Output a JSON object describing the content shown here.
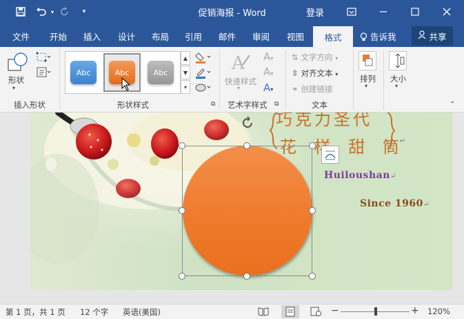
{
  "titlebar": {
    "doc_title": "促销海报 - Word",
    "login": "登录",
    "icons": [
      "save-icon",
      "undo-icon",
      "redo-icon",
      "customize-icon",
      "ribbon-display-icon",
      "minimize-icon",
      "maximize-icon",
      "close-icon"
    ]
  },
  "tabs": {
    "items": [
      "文件",
      "开始",
      "插入",
      "设计",
      "布局",
      "引用",
      "邮件",
      "审阅",
      "视图"
    ],
    "active": "格式",
    "tell_me": "告诉我",
    "share": "共享"
  },
  "ribbon": {
    "insert_shapes": {
      "shapes_label": "形状",
      "group_label": "插入形状"
    },
    "shape_styles": {
      "group_label": "形状样式",
      "presets": [
        {
          "label": "Abc",
          "color": "#4a90d9"
        },
        {
          "label": "Abc",
          "color": "#ed7d31"
        },
        {
          "label": "Abc",
          "color": "#a5a5a5"
        }
      ]
    },
    "wordart": {
      "quick_styles": "快速样式",
      "group_label": "艺术字样式"
    },
    "text": {
      "direction": "文字方向",
      "align": "对齐文本",
      "link": "创建链接",
      "group_label": "文本"
    },
    "arrange": {
      "label": "排列"
    },
    "size": {
      "label": "大小"
    }
  },
  "document": {
    "headline_line1": "巧克力圣代",
    "headline_line2": "花 样 甜 筒",
    "brand": "Huiloushan",
    "since": "Since 1960",
    "paragraph_mark": "↵"
  },
  "statusbar": {
    "page": "第 1 页，共 1 页",
    "words": "12 个字",
    "language": "英语(美国)",
    "zoom": "120%"
  },
  "colors": {
    "brand_blue": "#2b579a",
    "shape_orange": "#f07b2c",
    "brand_purple": "#7a3fa0",
    "since_brown": "#8a4a1c"
  }
}
